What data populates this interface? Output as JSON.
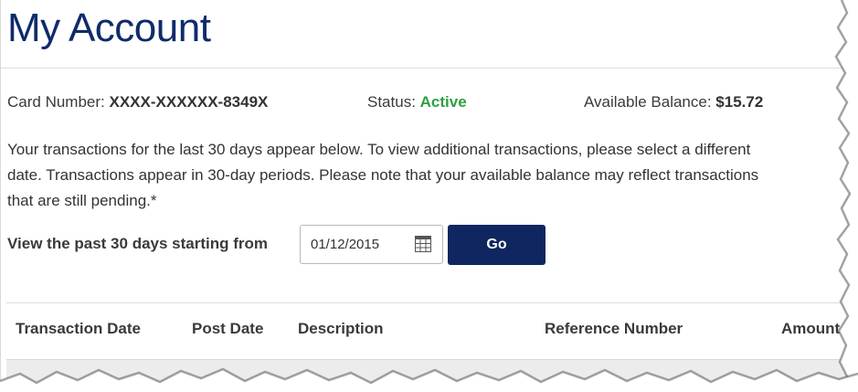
{
  "page": {
    "title": "My Account"
  },
  "account": {
    "card_label": "Card Number:",
    "card_value": "XXXX-XXXXXX-8349X",
    "status_label": "Status:",
    "status_value": "Active",
    "balance_label": "Available Balance:",
    "balance_value": "$15.72",
    "status_color": "#2e9e3e"
  },
  "description": {
    "line1": "Your transactions for the last 30 days appear below. To view additional transactions, please select a different",
    "line2": "date. Transactions appear in 30-day periods. Please note that your available balance may reflect transactions",
    "line3": "that are still pending.*"
  },
  "date_filter": {
    "label": "View the past 30 days starting from",
    "value": "01/12/2015",
    "icon": "calendar-icon",
    "go_label": "Go"
  },
  "table": {
    "columns": [
      "Transaction Date",
      "Post Date",
      "Description",
      "Reference Number",
      "Amount"
    ]
  },
  "colors": {
    "brand_navy": "#0f2660",
    "title_navy": "#0f2b6b"
  }
}
